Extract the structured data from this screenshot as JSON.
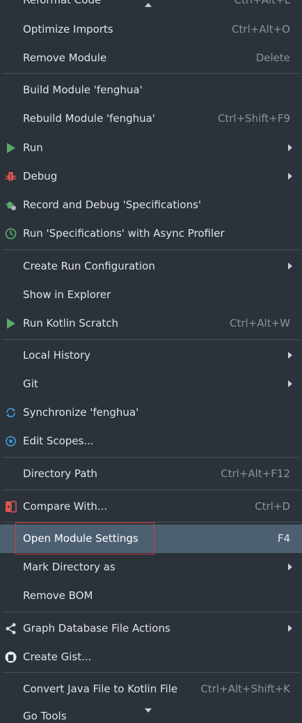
{
  "colors": {
    "background": "#2b3239",
    "selected_background": "#4d6072",
    "separator": "#47515a",
    "highlight_box": "#d9363e"
  },
  "menu": {
    "top_partial": {
      "label": "Reformat Code",
      "shortcut": "Ctrl+Alt+L"
    },
    "items": [
      {
        "label": "Optimize Imports",
        "shortcut": "Ctrl+Alt+O"
      },
      {
        "label": "Remove Module",
        "shortcut": "Delete"
      },
      {
        "label": "Build Module 'fenghua'",
        "shortcut": ""
      },
      {
        "label": "Rebuild Module 'fenghua'",
        "shortcut": "Ctrl+Shift+F9"
      },
      {
        "label": "Run",
        "icon": "run-icon",
        "submenu": true
      },
      {
        "label": "Debug",
        "icon": "debug-icon",
        "submenu": true
      },
      {
        "label": "Record and Debug 'Specifications'",
        "icon": "record-debug-icon"
      },
      {
        "label": "Run 'Specifications' with Async Profiler",
        "icon": "async-profiler-icon"
      },
      {
        "label": "Create Run Configuration",
        "submenu": true
      },
      {
        "label": "Show in Explorer"
      },
      {
        "label": "Run Kotlin Scratch",
        "icon": "run-icon",
        "shortcut": "Ctrl+Alt+W"
      },
      {
        "label": "Local History",
        "submenu": true
      },
      {
        "label": "Git",
        "submenu": true
      },
      {
        "label": "Synchronize 'fenghua'",
        "icon": "sync-icon"
      },
      {
        "label": "Edit Scopes...",
        "icon": "scopes-icon"
      },
      {
        "label": "Directory Path",
        "shortcut": "Ctrl+Alt+F12"
      },
      {
        "label": "Compare With...",
        "icon": "compare-icon",
        "shortcut": "Ctrl+D"
      },
      {
        "label": "Open Module Settings",
        "shortcut": "F4",
        "selected": true
      },
      {
        "label": "Mark Directory as",
        "submenu": true
      },
      {
        "label": "Remove BOM"
      },
      {
        "label": "Graph Database File Actions",
        "icon": "graph-icon",
        "submenu": true
      },
      {
        "label": "Create Gist...",
        "icon": "github-icon"
      },
      {
        "label": "Convert Java File to Kotlin File",
        "shortcut": "Ctrl+Alt+Shift+K"
      }
    ],
    "bottom_partial": {
      "label": "Go Tools"
    }
  }
}
